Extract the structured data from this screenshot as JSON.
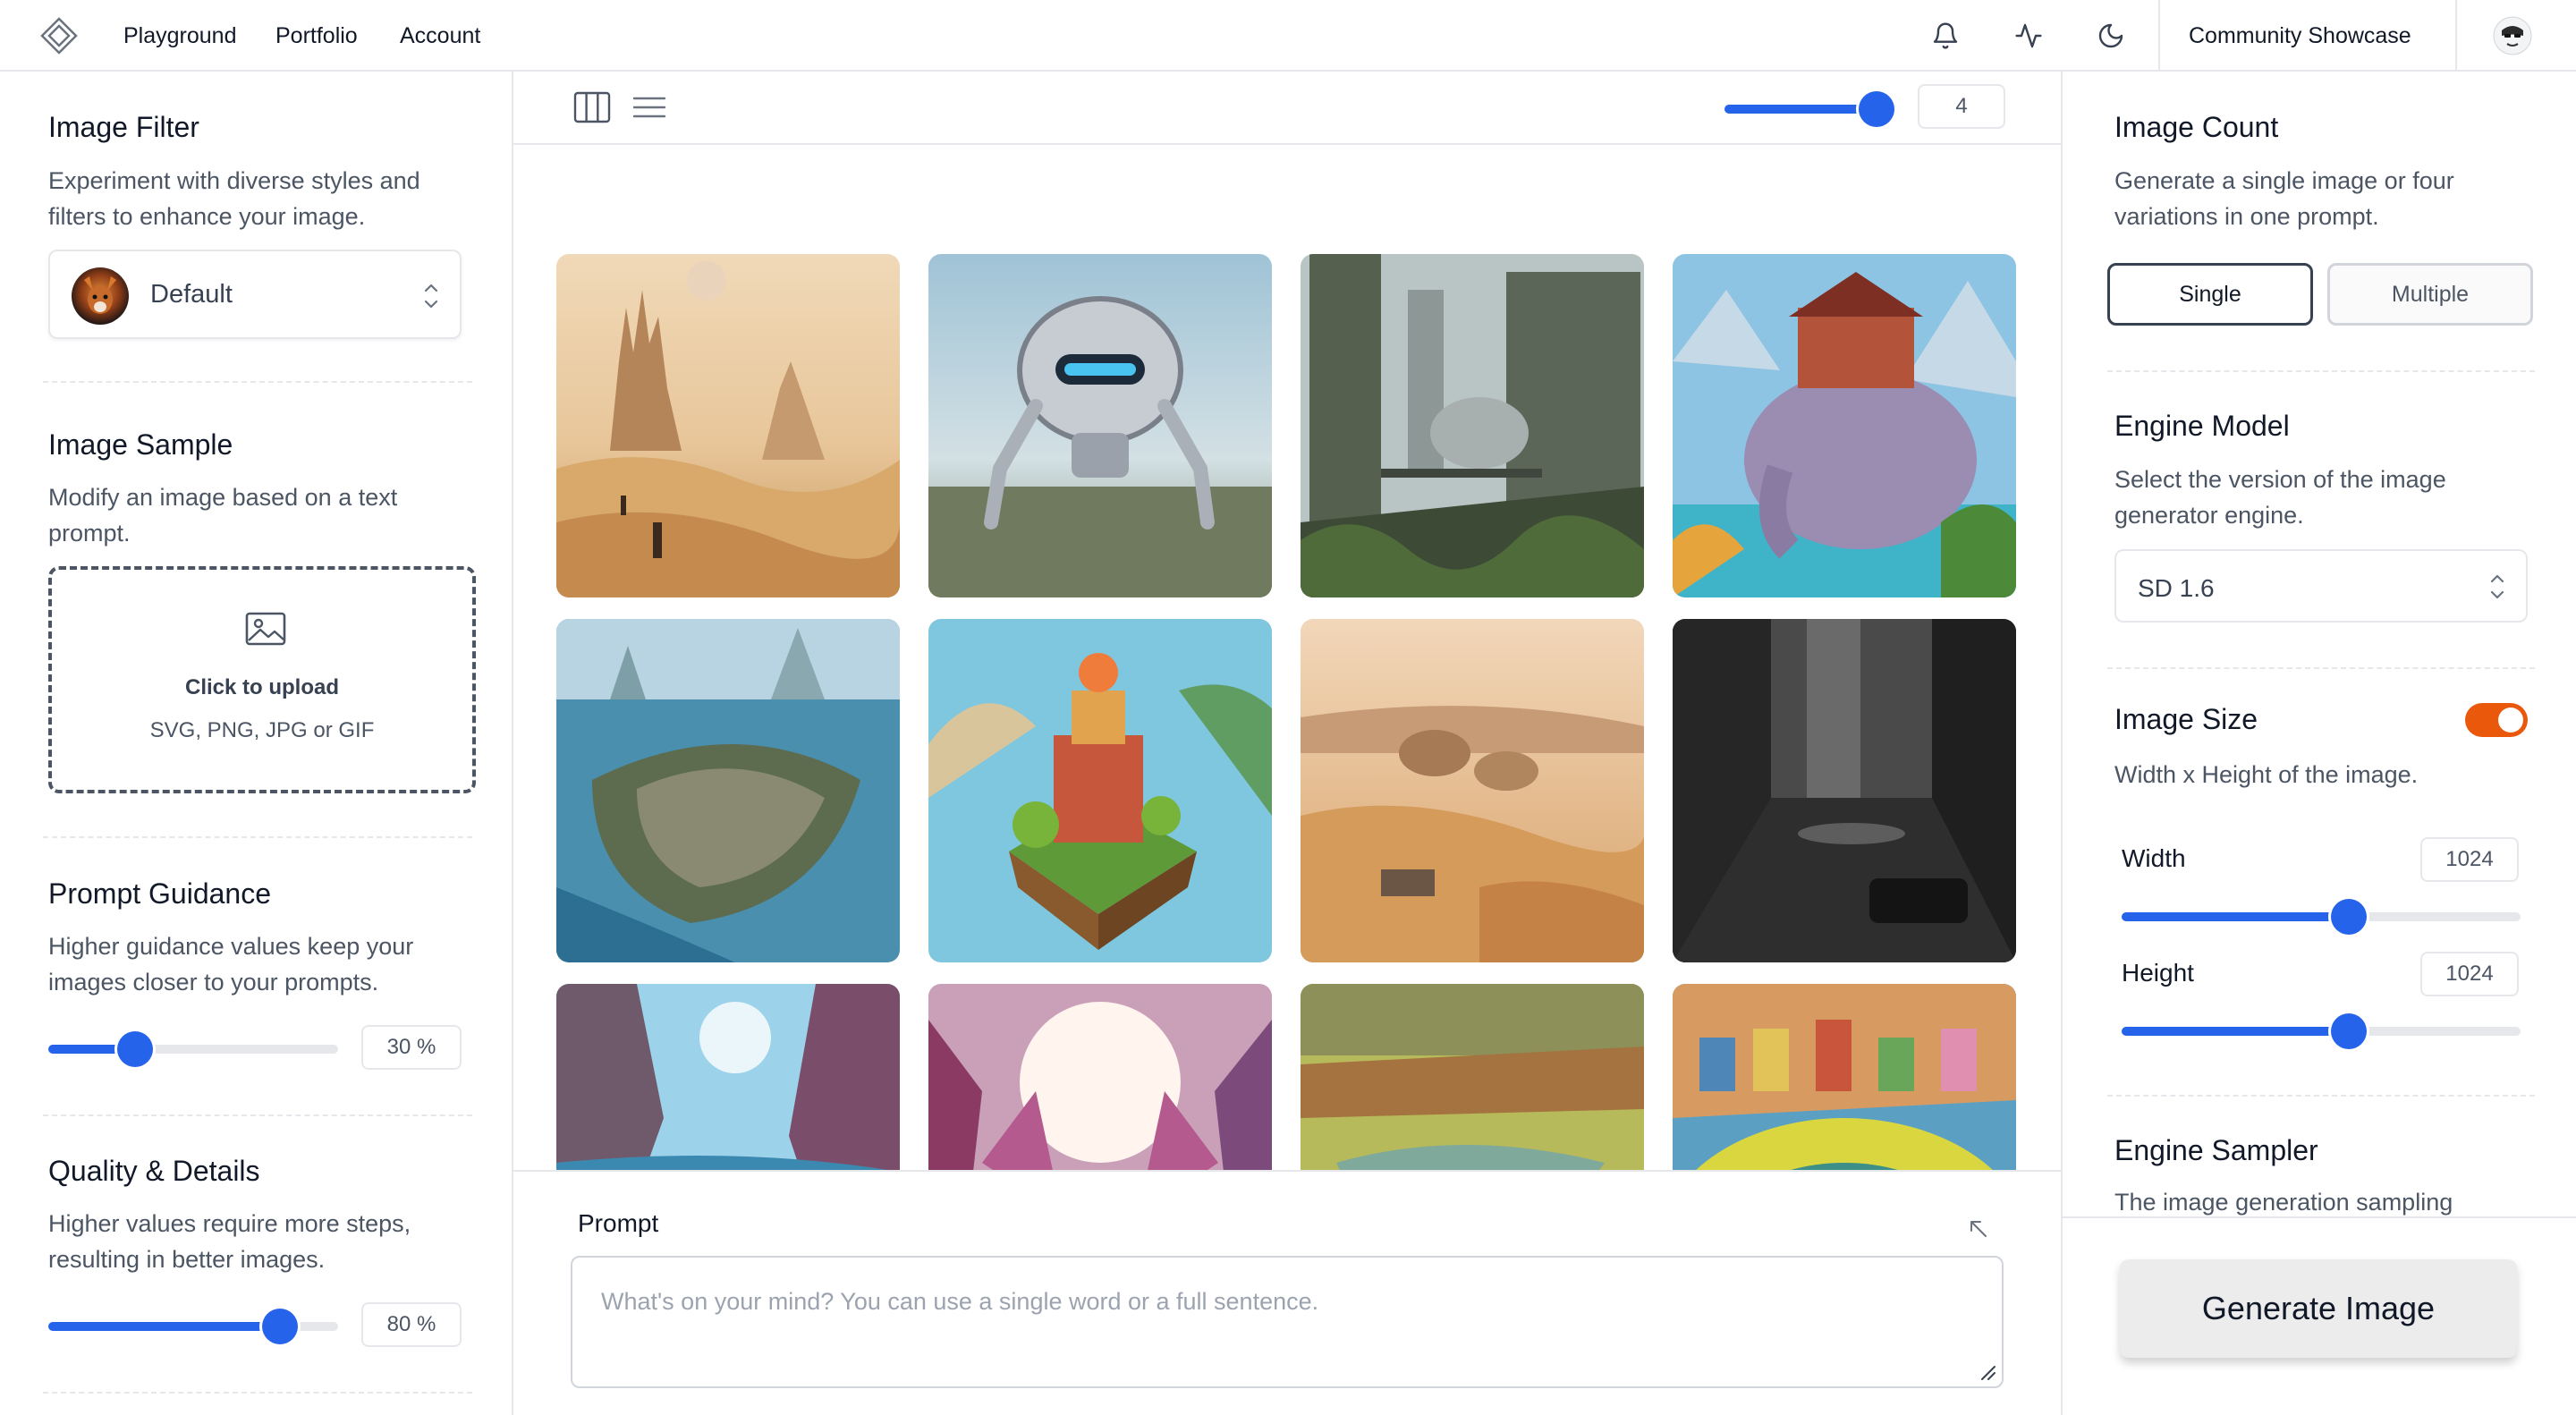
{
  "nav": {
    "links": [
      "Playground",
      "Portfolio",
      "Account"
    ],
    "icons": [
      "bell-icon",
      "activity-icon",
      "moon-icon"
    ],
    "showcase_label": "Community Showcase",
    "avatar_icon": "user-avatar"
  },
  "left": {
    "image_filter": {
      "title": "Image Filter",
      "description": "Experiment with diverse styles and filters to enhance your image.",
      "selected": "Default"
    },
    "image_sample": {
      "title": "Image Sample",
      "description": "Modify an image based on a text prompt.",
      "upload_title": "Click to upload",
      "upload_formats": "SVG, PNG, JPG or GIF"
    },
    "prompt_guidance": {
      "title": "Prompt Guidance",
      "description": "Higher guidance values keep your images closer to your prompts.",
      "value": 30,
      "value_label": "30 %"
    },
    "quality": {
      "title": "Quality & Details",
      "description": "Higher values require more steps, resulting in better images.",
      "value": 80,
      "value_label": "80 %"
    }
  },
  "center": {
    "toolbar": {
      "view_icons": [
        "columns-icon",
        "list-icon"
      ],
      "columns_value": 4,
      "columns_slider_fraction": 1.0
    },
    "gallery": [
      {
        "name": "desert-spires"
      },
      {
        "name": "robot-city"
      },
      {
        "name": "futuristic-skyscrapers"
      },
      {
        "name": "elephant-castle"
      },
      {
        "name": "island-city"
      },
      {
        "name": "floating-village"
      },
      {
        "name": "desert-domes"
      },
      {
        "name": "monochrome-street"
      },
      {
        "name": "coastal-canyon"
      },
      {
        "name": "crystal-sunburst"
      },
      {
        "name": "river-village"
      },
      {
        "name": "fish-pond-town"
      }
    ],
    "prompt": {
      "label": "Prompt",
      "placeholder": "What's on your mind? You can use a single word or a full sentence."
    }
  },
  "right": {
    "image_count": {
      "title": "Image Count",
      "description": "Generate a single image or four variations in one prompt.",
      "options": [
        "Single",
        "Multiple"
      ],
      "selected": "Single"
    },
    "engine_model": {
      "title": "Engine Model",
      "description": "Select the version of the image generator engine.",
      "selected": "SD 1.6"
    },
    "image_size": {
      "title": "Image Size",
      "description": "Width x Height of the image.",
      "enabled": true,
      "width_label": "Width",
      "width_value": "1024",
      "width_fraction": 0.57,
      "height_label": "Height",
      "height_value": "1024",
      "height_fraction": 0.57
    },
    "engine_sampler": {
      "title": "Engine Sampler",
      "description": "The image generation sampling"
    },
    "generate_label": "Generate Image"
  },
  "colors": {
    "accent": "#2563eb",
    "toggle_on": "#ea580c",
    "border": "#e5e7eb"
  }
}
